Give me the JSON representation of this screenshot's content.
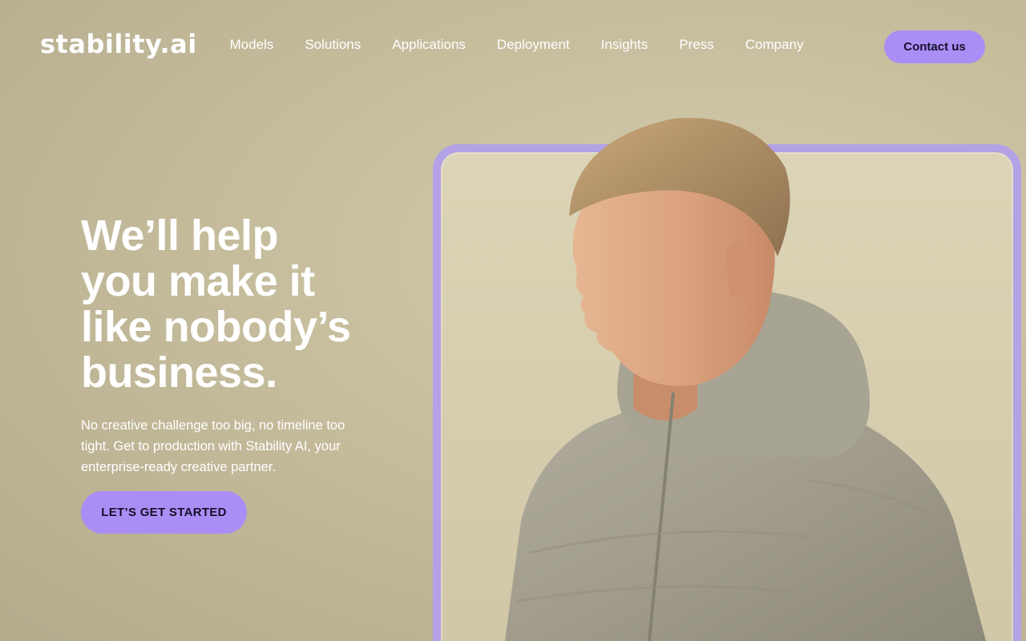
{
  "brand": {
    "logo": "stability.ai"
  },
  "nav": {
    "items": [
      {
        "label": "Models"
      },
      {
        "label": "Solutions"
      },
      {
        "label": "Applications"
      },
      {
        "label": "Deployment"
      },
      {
        "label": "Insights"
      },
      {
        "label": "Press"
      },
      {
        "label": "Company"
      }
    ],
    "contact_label": "Contact us"
  },
  "hero": {
    "headline": [
      "We’ll help",
      "you make it",
      "like nobody’s",
      "business."
    ],
    "subtitle": "No creative challenge too big, no timeline too tight. Get to production with Stability AI, your enterprise-ready creative partner.",
    "cta_label": "LET’S GET STARTED"
  },
  "colors": {
    "accent": "#a98ff5",
    "frame": "#b3a2e6",
    "background": "#c6bd9d"
  }
}
